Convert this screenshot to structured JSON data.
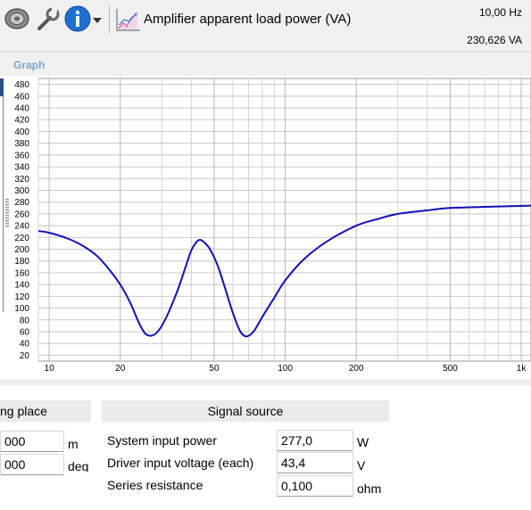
{
  "toolbar": {
    "icons": [
      "speaker-icon",
      "wrench-icon",
      "info-icon",
      "dropdown-arrow-icon",
      "chart-icon"
    ],
    "title": "Amplifier apparent load power (VA)",
    "frequency_readout": "10,00 Hz",
    "value_readout": "230,626 VA"
  },
  "graph": {
    "section_label": "Graph"
  },
  "chart_data": {
    "type": "line",
    "title": "",
    "xlabel": "",
    "ylabel": "",
    "x_scale": "log",
    "xlim": [
      9,
      1100
    ],
    "ylim": [
      10,
      490
    ],
    "x_tick_labels": [
      "10",
      "20",
      "50",
      "100",
      "200",
      "500",
      "1k"
    ],
    "y_tick_labels": [
      "20",
      "40",
      "60",
      "80",
      "100",
      "120",
      "140",
      "160",
      "180",
      "200",
      "220",
      "240",
      "260",
      "280",
      "300",
      "320",
      "340",
      "360",
      "380",
      "400",
      "420",
      "440",
      "460",
      "480"
    ],
    "grid": true,
    "series": [
      {
        "color": "#1010b4",
        "points": [
          [
            9,
            231
          ],
          [
            10,
            228
          ],
          [
            12,
            218
          ],
          [
            14,
            205
          ],
          [
            16,
            188
          ],
          [
            18,
            165
          ],
          [
            20,
            140
          ],
          [
            22,
            110
          ],
          [
            24,
            75
          ],
          [
            25.5,
            57
          ],
          [
            27,
            53
          ],
          [
            28.5,
            58
          ],
          [
            30,
            70
          ],
          [
            32,
            92
          ],
          [
            35,
            130
          ],
          [
            38,
            172
          ],
          [
            40,
            198
          ],
          [
            42,
            212
          ],
          [
            43.5,
            216
          ],
          [
            45,
            213
          ],
          [
            48,
            200
          ],
          [
            52,
            170
          ],
          [
            56,
            130
          ],
          [
            60,
            92
          ],
          [
            64,
            63
          ],
          [
            67,
            53
          ],
          [
            70,
            53
          ],
          [
            74,
            62
          ],
          [
            80,
            85
          ],
          [
            90,
            118
          ],
          [
            100,
            147
          ],
          [
            120,
            183
          ],
          [
            150,
            213
          ],
          [
            200,
            240
          ],
          [
            250,
            252
          ],
          [
            300,
            260
          ],
          [
            400,
            266
          ],
          [
            500,
            270
          ],
          [
            700,
            272
          ],
          [
            900,
            273
          ],
          [
            1100,
            274
          ]
        ]
      }
    ]
  },
  "placement_panel": {
    "header": "ng place",
    "fields": [
      {
        "value": "000",
        "unit": "m"
      },
      {
        "value": "000",
        "unit": "deg"
      }
    ]
  },
  "signal_source": {
    "header": "Signal source",
    "rows": [
      {
        "label": "System input power",
        "value": "277,0",
        "unit": "W"
      },
      {
        "label": "Driver input voltage (each)",
        "value": "43,4",
        "unit": "V"
      },
      {
        "label": "Series resistance",
        "value": "0,100",
        "unit": "ohm"
      }
    ]
  }
}
